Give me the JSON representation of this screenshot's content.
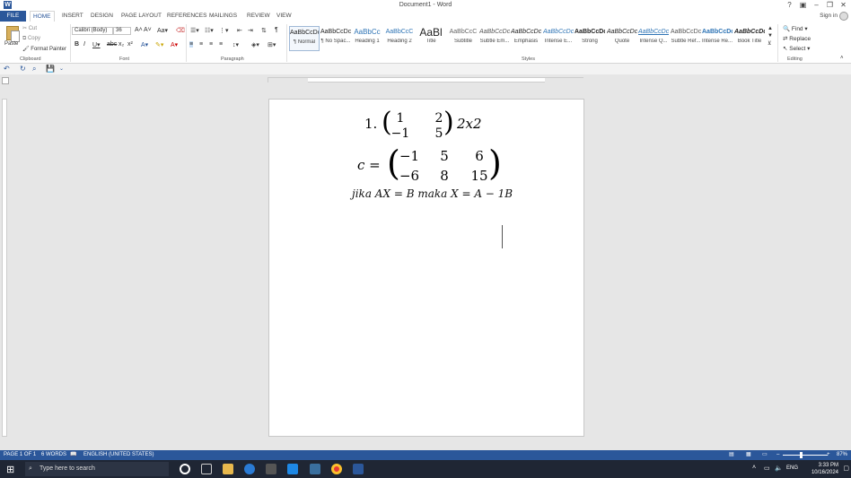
{
  "window": {
    "title": "Document1 - Word",
    "sign_in": "Sign in"
  },
  "tabs": [
    "FILE",
    "HOME",
    "INSERT",
    "DESIGN",
    "PAGE LAYOUT",
    "REFERENCES",
    "MAILINGS",
    "REVIEW",
    "VIEW"
  ],
  "active_tab": "HOME",
  "clipboard": {
    "paste": "Paste",
    "cut": "Cut",
    "copy": "Copy",
    "format_painter": "Format Painter",
    "label": "Clipboard"
  },
  "font": {
    "name": "Calibri (Body)",
    "size": "36",
    "label": "Font"
  },
  "paragraph": {
    "label": "Paragraph"
  },
  "styles": {
    "label": "Styles",
    "items": [
      {
        "sample": "AaBbCcDc",
        "name": "¶ Normal"
      },
      {
        "sample": "AaBbCcDc",
        "name": "¶ No Spac..."
      },
      {
        "sample": "AaBbCc",
        "name": "Heading 1"
      },
      {
        "sample": "AaBbCcC",
        "name": "Heading 2"
      },
      {
        "sample": "AaBl",
        "name": "Title"
      },
      {
        "sample": "AaBbCcC",
        "name": "Subtitle"
      },
      {
        "sample": "AaBbCcDc",
        "name": "Subtle Em..."
      },
      {
        "sample": "AaBbCcDc",
        "name": "Emphasis"
      },
      {
        "sample": "AaBbCcDc",
        "name": "Intense E..."
      },
      {
        "sample": "AaBbCcDc",
        "name": "Strong"
      },
      {
        "sample": "AaBbCcDc",
        "name": "Quote"
      },
      {
        "sample": "AaBbCcDc",
        "name": "Intense Q..."
      },
      {
        "sample": "AaBbCcDc",
        "name": "Subtle Ref..."
      },
      {
        "sample": "AaBbCcDc",
        "name": "Intense Re..."
      },
      {
        "sample": "AaBbCcDc",
        "name": "Book Title"
      }
    ]
  },
  "editing": {
    "find": "Find",
    "replace": "Replace",
    "select": "Select",
    "label": "Editing"
  },
  "document": {
    "line1_prefix": "1.",
    "matrix1": [
      [
        "1",
        "2"
      ],
      [
        "−1",
        "5"
      ]
    ],
    "line1_suffix": "2x2",
    "line2_prefix": "c =",
    "matrix2": [
      [
        "−1",
        "5",
        "6"
      ],
      [
        "−6",
        "8",
        "15"
      ]
    ],
    "line3": "jika AX = B maka X = A − 1B"
  },
  "status": {
    "page": "PAGE 1 OF 1",
    "words": "6 WORDS",
    "language": "ENGLISH (UNITED STATES)",
    "zoom": "87%"
  },
  "taskbar": {
    "search_placeholder": "Type here to search",
    "time": "3:33 PM",
    "date": "10/16/2024",
    "lang": "ENG"
  },
  "colors": {
    "accent": "#2b579a"
  }
}
